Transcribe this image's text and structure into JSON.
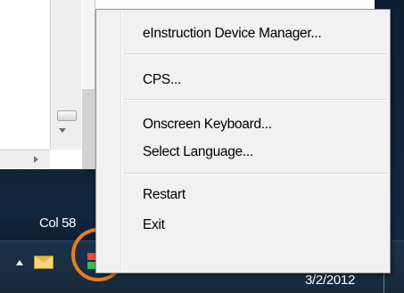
{
  "editor": {
    "status_column": "Col 58"
  },
  "taskbar": {
    "clock_date": "3/2/2012"
  },
  "context_menu": {
    "items": [
      {
        "label": "eInstruction Device Manager..."
      },
      {
        "label": "CPS..."
      },
      {
        "label": "Onscreen Keyboard..."
      },
      {
        "label": "Select Language..."
      },
      {
        "label": "Restart"
      },
      {
        "label": "Exit"
      }
    ]
  },
  "colors": {
    "highlight_circle": "#ea7b20",
    "desktop_bg": "#10283f",
    "menu_bg": "#f1f1f1"
  },
  "icons": {
    "tray_overflow": "chevron-up-icon",
    "mail": "envelope-icon",
    "cps_app": "cps-tray-icon"
  }
}
